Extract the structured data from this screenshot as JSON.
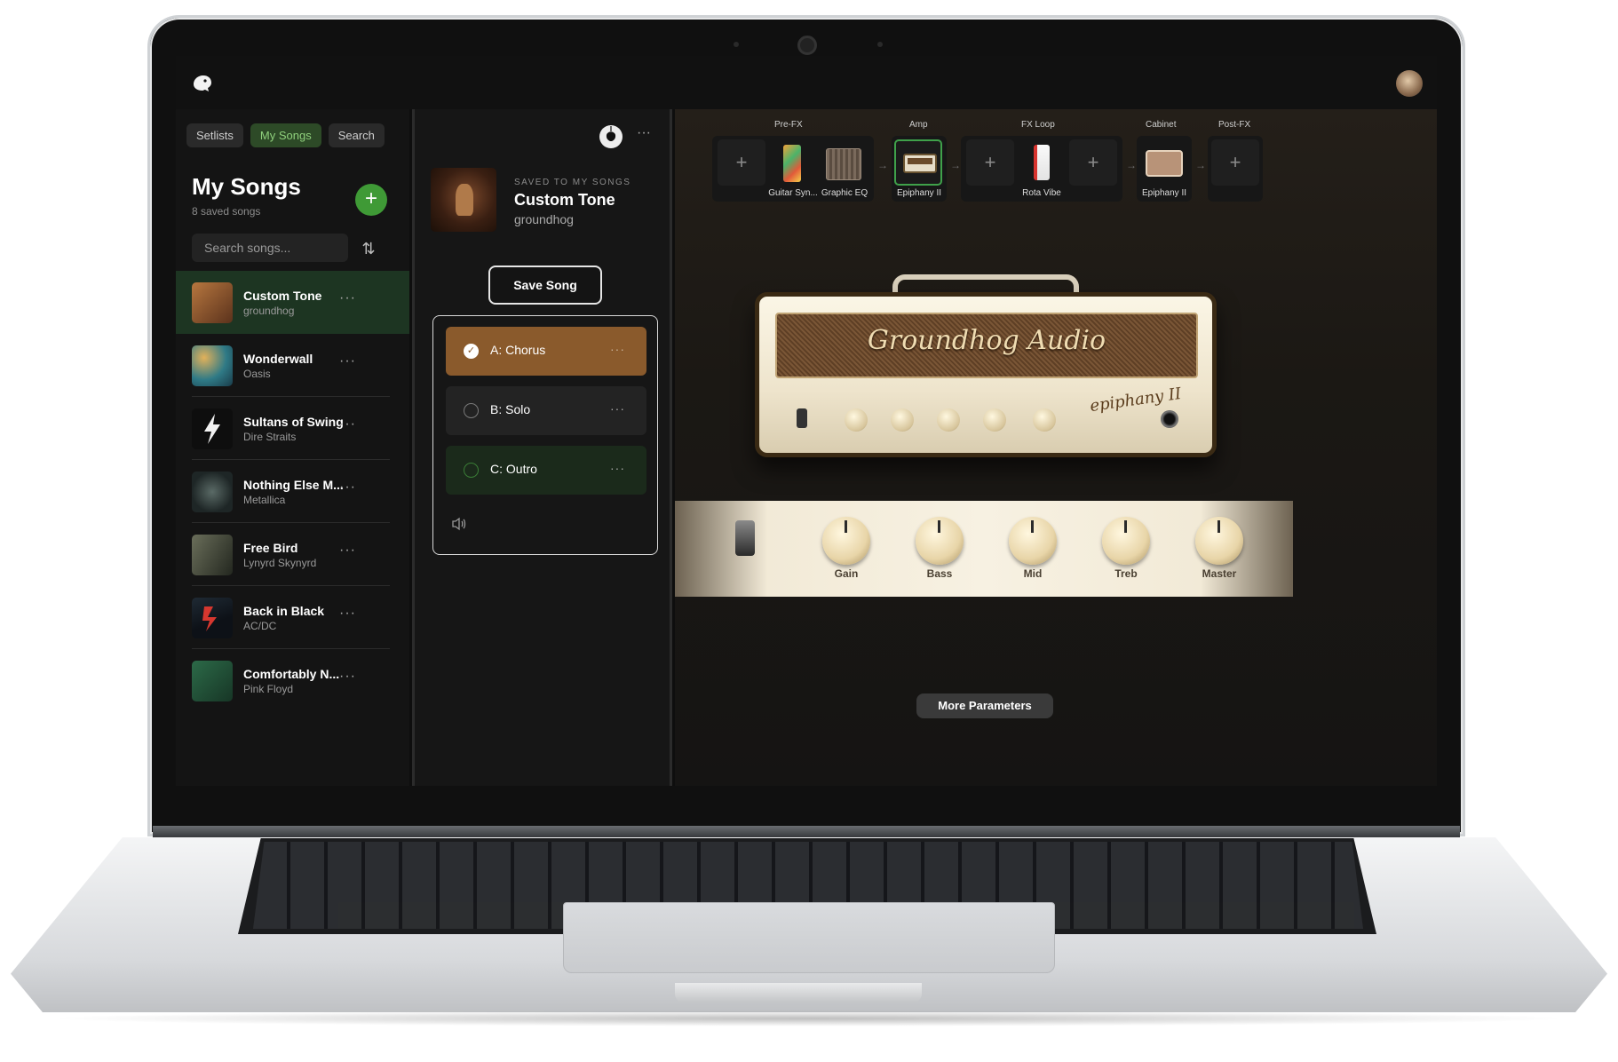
{
  "app": {
    "brand": "Groundhog Audio",
    "logo_icon": "groundhog-logo-icon"
  },
  "left_panel": {
    "tabs": [
      {
        "label": "Setlists",
        "active": false
      },
      {
        "label": "My Songs",
        "active": true
      },
      {
        "label": "Search",
        "active": false
      }
    ],
    "title": "My Songs",
    "subtitle": "8 saved songs",
    "add_icon": "+",
    "search_placeholder": "Search songs...",
    "sort_icon": "⇅",
    "songs": [
      {
        "title": "Custom Tone",
        "artist": "groundhog",
        "active": true,
        "art_color": "#7a4a2a"
      },
      {
        "title": "Wonderwall",
        "artist": "Oasis",
        "active": false,
        "art_color": "#2f7a86"
      },
      {
        "title": "Sultans of Swing",
        "artist": "Dire Straits",
        "active": false,
        "art_color": "#111111"
      },
      {
        "title": "Nothing Else M...",
        "artist": "Metallica",
        "active": false,
        "art_color": "#3a4a4a"
      },
      {
        "title": "Free Bird",
        "artist": "Lynyrd Skynyrd",
        "active": false,
        "art_color": "#444a3a"
      },
      {
        "title": "Back in Black",
        "artist": "AC/DC",
        "active": false,
        "art_color": "#1f2a34"
      },
      {
        "title": "Comfortably N...",
        "artist": "Pink Floyd",
        "active": false,
        "art_color": "#2c6a48"
      }
    ],
    "more_icon": "···"
  },
  "middle_panel": {
    "saved_label": "SAVED TO MY SONGS",
    "song_title": "Custom Tone",
    "song_artist": "groundhog",
    "save_button": "Save Song",
    "sections": [
      {
        "label": "A: Chorus",
        "selected": true
      },
      {
        "label": "B: Solo",
        "selected": false
      },
      {
        "label": "C: Outro",
        "selected": false
      }
    ],
    "more_icon": "···",
    "check_icon": "✓",
    "speaker_icon": "🔈"
  },
  "right_panel": {
    "chain": {
      "groups": [
        {
          "label": "Pre-FX",
          "slots": [
            "+",
            "Guitar Syn...",
            "Graphic EQ"
          ]
        },
        {
          "label": "Amp",
          "slots": [
            "Epiphany II"
          ]
        },
        {
          "label": "FX Loop",
          "slots": [
            "+",
            "Rota Vibe",
            "+"
          ]
        },
        {
          "label": "Cabinet",
          "slots": [
            "Epiphany II"
          ]
        },
        {
          "label": "Post-FX",
          "slots": [
            "+"
          ]
        }
      ],
      "add_icon": "+",
      "arrow_icon": "→"
    },
    "amp": {
      "brand_script": "Groundhog Audio",
      "model_script": "epiphany II"
    },
    "knobs": [
      {
        "label": "Gain"
      },
      {
        "label": "Bass"
      },
      {
        "label": "Mid"
      },
      {
        "label": "Treb"
      },
      {
        "label": "Master"
      }
    ],
    "more_params_button": "More Parameters"
  }
}
